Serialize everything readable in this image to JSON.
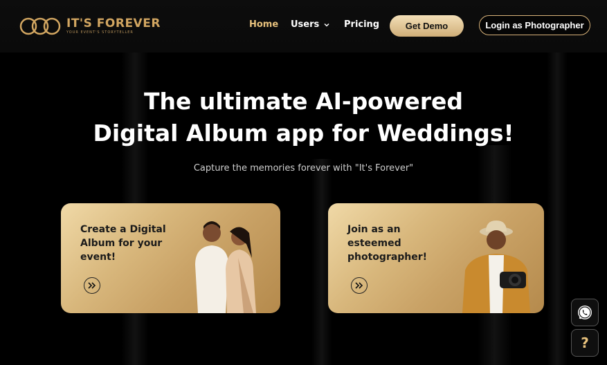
{
  "brand": {
    "name": "IT'S FOREVER",
    "tagline": "YOUR EVENT'S STORYTELLER",
    "logo_icon": "infinity-rings-icon"
  },
  "nav": {
    "home": "Home",
    "users": "Users",
    "pricing": "Pricing",
    "get_demo": "Get Demo",
    "login": "Login as Photographer"
  },
  "hero": {
    "title_line1": "The ultimate AI-powered",
    "title_line2": "Digital Album app for Weddings!",
    "subtitle": "Capture the memories forever with \"It's Forever\""
  },
  "cards": [
    {
      "label": "Create a Digital Album for your event!",
      "icon": "double-chevron-right-icon",
      "image": "couple-illustration"
    },
    {
      "label": "Join as an esteemed photographer!",
      "icon": "double-chevron-right-icon",
      "image": "photographer-illustration"
    }
  ],
  "floating": {
    "whatsapp_icon": "whatsapp-icon",
    "help_label": "?"
  },
  "colors": {
    "accent": "#d9b37a",
    "background": "#000000",
    "card_gradient_start": "#f0d9a7",
    "card_gradient_end": "#b58a4c"
  }
}
